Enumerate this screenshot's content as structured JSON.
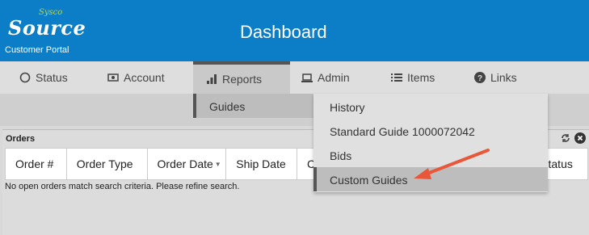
{
  "header": {
    "logo_small": "Sysco",
    "logo_main": "Source",
    "portal_label": "Customer Portal",
    "title": "Dashboard",
    "color": "#0b7ec7"
  },
  "nav": {
    "items": [
      {
        "label": "Status",
        "icon": "circle-icon"
      },
      {
        "label": "Account",
        "icon": "money-icon"
      },
      {
        "label": "Reports",
        "icon": "bar-chart-icon",
        "active": true
      },
      {
        "label": "Admin",
        "icon": "laptop-icon"
      },
      {
        "label": "Items",
        "icon": "list-icon"
      },
      {
        "label": "Links",
        "icon": "question-circle-icon"
      }
    ]
  },
  "subnav": {
    "guides_label": "Guides"
  },
  "dropdown": {
    "items": [
      {
        "label": "History"
      },
      {
        "label": "Standard Guide 1000072042"
      },
      {
        "label": "Bids"
      },
      {
        "label": "Custom Guides",
        "highlighted": true
      }
    ]
  },
  "orders": {
    "title": "Orders",
    "columns": [
      "Order #",
      "Order Type",
      "Order Date",
      "Ship Date",
      "C",
      "Status"
    ],
    "empty_message": "No open orders match search criteria. Please refine search."
  },
  "annotation": {
    "arrow_color": "#e8573a"
  }
}
